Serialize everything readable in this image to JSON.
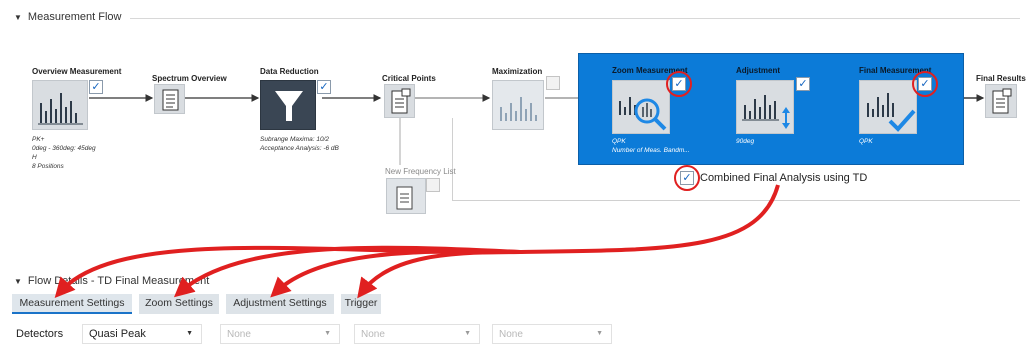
{
  "flow_section": {
    "title": "Measurement Flow"
  },
  "nodes": {
    "overview": {
      "title": "Overview Measurement",
      "meta": [
        "PK+",
        "0deg - 360deg: 45deg",
        "H",
        "8 Positions"
      ]
    },
    "spectrum": {
      "title": "Spectrum Overview"
    },
    "reduction": {
      "title": "Data Reduction",
      "meta": [
        "Subrange Maxima: 10/2",
        "Acceptance Analysis: -6 dB"
      ]
    },
    "critical": {
      "title": "Critical Points"
    },
    "new_freq": {
      "title": "New Frequency List"
    },
    "maximization": {
      "title": "Maximization"
    },
    "zoom": {
      "title": "Zoom Measurement",
      "meta": [
        "QPK",
        "Number of Meas. Bandm..."
      ]
    },
    "adjustment": {
      "title": "Adjustment",
      "meta": [
        "90deg"
      ]
    },
    "final": {
      "title": "Final Measurement",
      "meta": [
        "QPK"
      ]
    },
    "results": {
      "title": "Final Results"
    }
  },
  "combined_label": "Combined Final Analysis using TD",
  "details_section": {
    "title": "Flow Details - TD Final Measurement"
  },
  "tabs": [
    {
      "label": "Measurement Settings"
    },
    {
      "label": "Zoom Settings"
    },
    {
      "label": "Adjustment Settings"
    },
    {
      "label": "Trigger"
    }
  ],
  "detectors": {
    "label": "Detectors",
    "selects": [
      "Quasi Peak",
      "None",
      "None",
      "None"
    ]
  },
  "colors": {
    "accent_blue": "#0c7bd8",
    "highlight_red": "#e02020",
    "tab_active": "#1a73c8"
  }
}
